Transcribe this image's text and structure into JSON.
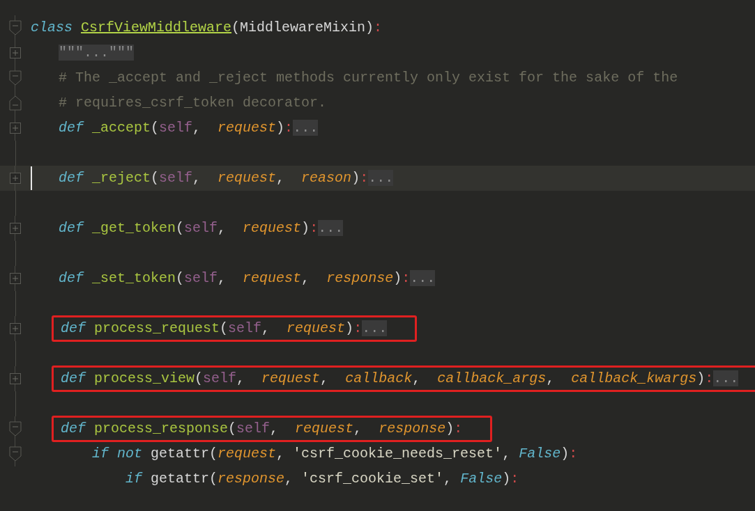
{
  "editor": {
    "lines": [
      {
        "kind": "open",
        "current": false,
        "boxed": false,
        "tokens": [
          {
            "kind": "kw",
            "s": "class "
          },
          {
            "kind": "cls",
            "s": "CsrfViewMiddleware"
          },
          {
            "kind": "punct",
            "s": "(MiddlewareMixin)"
          },
          {
            "kind": "colon",
            "s": ":"
          }
        ]
      },
      {
        "kind": "collapsed",
        "current": false,
        "boxed": false,
        "tokens": [
          {
            "kind": "fold",
            "s": "\"\"\"...\"\"\""
          }
        ]
      },
      {
        "kind": "open",
        "current": false,
        "boxed": false,
        "tokens": [
          {
            "kind": "comment",
            "s": "# The _accept and _reject methods currently only exist for the sake of the"
          }
        ]
      },
      {
        "kind": "close",
        "current": false,
        "boxed": false,
        "tokens": [
          {
            "kind": "comment",
            "s": "# requires_csrf_token decorator."
          }
        ]
      },
      {
        "kind": "collapsed",
        "current": false,
        "boxed": false,
        "tokens": [
          {
            "kind": "kw",
            "s": "def "
          },
          {
            "kind": "fn",
            "s": "_accept"
          },
          {
            "kind": "punct",
            "s": "("
          },
          {
            "kind": "self",
            "s": "self"
          },
          {
            "kind": "punct",
            "s": ",  "
          },
          {
            "kind": "param",
            "s": "request"
          },
          {
            "kind": "punct",
            "s": ")"
          },
          {
            "kind": "colon",
            "s": ":"
          },
          {
            "kind": "fold",
            "s": "..."
          }
        ]
      },
      {
        "kind": "blank"
      },
      {
        "kind": "collapsed",
        "current": true,
        "boxed": false,
        "tokens": [
          {
            "kind": "kw",
            "s": "def "
          },
          {
            "kind": "fn",
            "s": "_reject"
          },
          {
            "kind": "punct",
            "s": "("
          },
          {
            "kind": "self",
            "s": "self"
          },
          {
            "kind": "punct",
            "s": ",  "
          },
          {
            "kind": "param",
            "s": "request"
          },
          {
            "kind": "punct",
            "s": ",  "
          },
          {
            "kind": "param",
            "s": "reason"
          },
          {
            "kind": "punct",
            "s": ")"
          },
          {
            "kind": "colon",
            "s": ":"
          },
          {
            "kind": "fold",
            "s": "..."
          }
        ]
      },
      {
        "kind": "blank"
      },
      {
        "kind": "collapsed",
        "current": false,
        "boxed": false,
        "tokens": [
          {
            "kind": "kw",
            "s": "def "
          },
          {
            "kind": "fn",
            "s": "_get_token"
          },
          {
            "kind": "punct",
            "s": "("
          },
          {
            "kind": "self",
            "s": "self"
          },
          {
            "kind": "punct",
            "s": ",  "
          },
          {
            "kind": "param",
            "s": "request"
          },
          {
            "kind": "punct",
            "s": ")"
          },
          {
            "kind": "colon",
            "s": ":"
          },
          {
            "kind": "fold",
            "s": "..."
          }
        ]
      },
      {
        "kind": "blank"
      },
      {
        "kind": "collapsed",
        "current": false,
        "boxed": false,
        "tokens": [
          {
            "kind": "kw",
            "s": "def "
          },
          {
            "kind": "fn",
            "s": "_set_token"
          },
          {
            "kind": "punct",
            "s": "("
          },
          {
            "kind": "self",
            "s": "self"
          },
          {
            "kind": "punct",
            "s": ",  "
          },
          {
            "kind": "param",
            "s": "request"
          },
          {
            "kind": "punct",
            "s": ",  "
          },
          {
            "kind": "param",
            "s": "response"
          },
          {
            "kind": "punct",
            "s": ")"
          },
          {
            "kind": "colon",
            "s": ":"
          },
          {
            "kind": "fold",
            "s": "..."
          }
        ]
      },
      {
        "kind": "blank"
      },
      {
        "kind": "collapsed",
        "current": false,
        "boxed": true,
        "tokens": [
          {
            "kind": "kw",
            "s": "def "
          },
          {
            "kind": "fn",
            "s": "process_request"
          },
          {
            "kind": "punct",
            "s": "("
          },
          {
            "kind": "self",
            "s": "self"
          },
          {
            "kind": "punct",
            "s": ",  "
          },
          {
            "kind": "param",
            "s": "request"
          },
          {
            "kind": "punct",
            "s": ")"
          },
          {
            "kind": "colon",
            "s": ":"
          },
          {
            "kind": "fold",
            "s": "..."
          }
        ]
      },
      {
        "kind": "blank"
      },
      {
        "kind": "collapsed",
        "current": false,
        "boxed": true,
        "tokens": [
          {
            "kind": "kw",
            "s": "def "
          },
          {
            "kind": "fn",
            "s": "process_view"
          },
          {
            "kind": "punct",
            "s": "("
          },
          {
            "kind": "self",
            "s": "self"
          },
          {
            "kind": "punct",
            "s": ",  "
          },
          {
            "kind": "param",
            "s": "request"
          },
          {
            "kind": "punct",
            "s": ",  "
          },
          {
            "kind": "param",
            "s": "callback"
          },
          {
            "kind": "punct",
            "s": ",  "
          },
          {
            "kind": "param",
            "s": "callback_args"
          },
          {
            "kind": "punct",
            "s": ",  "
          },
          {
            "kind": "param",
            "s": "callback_kwargs"
          },
          {
            "kind": "punct",
            "s": ")"
          },
          {
            "kind": "colon",
            "s": ":"
          },
          {
            "kind": "fold",
            "s": "..."
          }
        ]
      },
      {
        "kind": "blank"
      },
      {
        "kind": "open",
        "current": false,
        "boxed": true,
        "tokens": [
          {
            "kind": "kw",
            "s": "def "
          },
          {
            "kind": "fn",
            "s": "process_response"
          },
          {
            "kind": "punct",
            "s": "("
          },
          {
            "kind": "self",
            "s": "self"
          },
          {
            "kind": "punct",
            "s": ",  "
          },
          {
            "kind": "param",
            "s": "request"
          },
          {
            "kind": "punct",
            "s": ",  "
          },
          {
            "kind": "param",
            "s": "response"
          },
          {
            "kind": "punct",
            "s": ")"
          },
          {
            "kind": "colon",
            "s": ":"
          }
        ]
      },
      {
        "kind": "open",
        "current": false,
        "boxed": false,
        "tokens": [
          {
            "kind": "kw",
            "s": "if not "
          },
          {
            "kind": "plain",
            "s": "getattr("
          },
          {
            "kind": "param",
            "s": "request"
          },
          {
            "kind": "punct",
            "s": ", "
          },
          {
            "kind": "string",
            "s": "'csrf_cookie_needs_reset'"
          },
          {
            "kind": "punct",
            "s": ", "
          },
          {
            "kind": "const",
            "s": "False"
          },
          {
            "kind": "punct",
            "s": ")"
          },
          {
            "kind": "colon",
            "s": ":"
          }
        ]
      },
      {
        "kind": "plain",
        "current": false,
        "boxed": false,
        "tokens": [
          {
            "kind": "kw",
            "s": "if "
          },
          {
            "kind": "plain",
            "s": "getattr("
          },
          {
            "kind": "param",
            "s": "response"
          },
          {
            "kind": "punct",
            "s": ", "
          },
          {
            "kind": "string",
            "s": "'csrf_cookie_set'"
          },
          {
            "kind": "punct",
            "s": ", "
          },
          {
            "kind": "const",
            "s": "False"
          },
          {
            "kind": "punct",
            "s": ")"
          },
          {
            "kind": "colon",
            "s": ":"
          }
        ]
      }
    ]
  }
}
